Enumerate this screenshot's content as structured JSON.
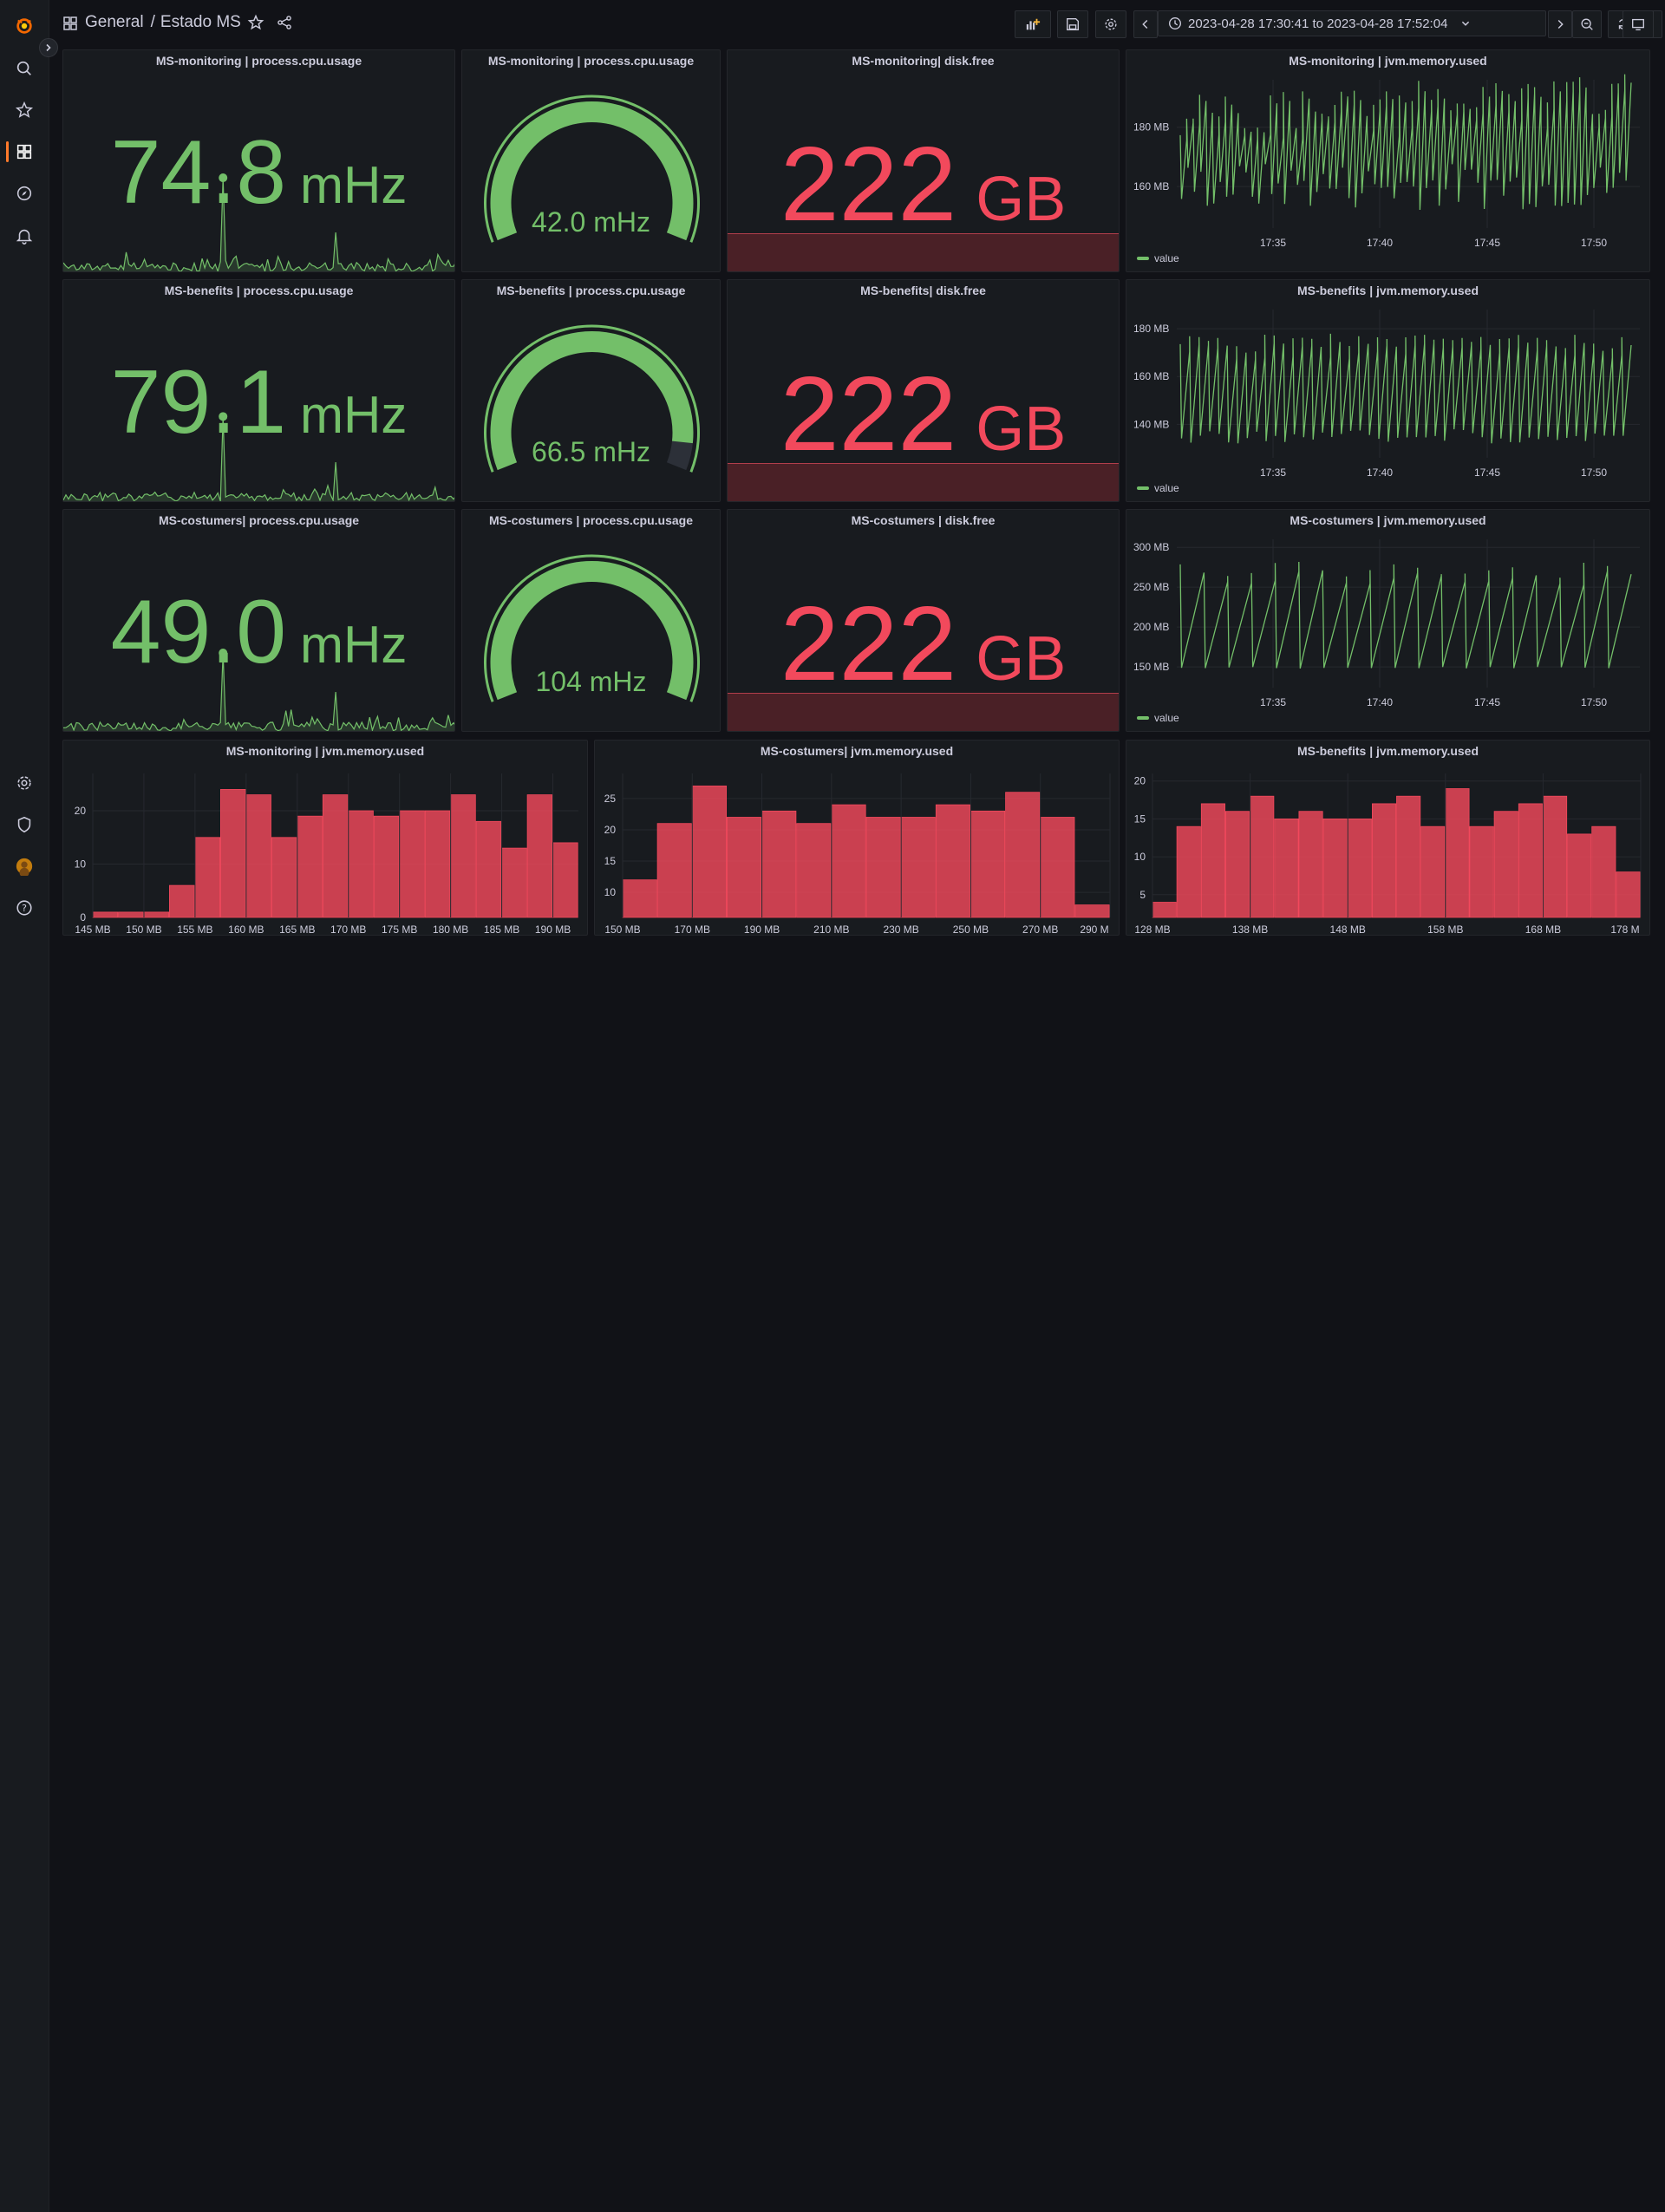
{
  "header": {
    "folder": "General",
    "separator": "/",
    "dashboard": "Estado MS",
    "time_range": "2023-04-28 17:30:41 to 2023-04-28 17:52:04"
  },
  "colors": {
    "green": "#73bf69",
    "red": "#f2495c",
    "bg": "#111217",
    "panel": "#181b1f"
  },
  "icons": {
    "sidebar": [
      "grafana-logo",
      "search-icon",
      "star-icon",
      "dashboards-icon",
      "explore-icon",
      "alerting-icon",
      "settings-icon",
      "shield-icon",
      "avatar",
      "help-icon"
    ],
    "toolbar": [
      "add-panel-icon",
      "save-icon",
      "settings-icon",
      "chevron-left-icon",
      "clock-icon",
      "chevron-down-icon",
      "chevron-right-icon",
      "zoom-out-icon",
      "refresh-icon",
      "chevron-down-icon",
      "tv-mode-icon"
    ]
  },
  "panels": {
    "cpu_stats": [
      {
        "title": "MS-monitoring | process.cpu.usage",
        "value": "74.8",
        "unit": "mHz",
        "spike_ratio": 0.42
      },
      {
        "title": "MS-benefits | process.cpu.usage",
        "value": "79.1",
        "unit": "mHz",
        "spike_ratio": 0.38
      },
      {
        "title": "MS-costumers| process.cpu.usage",
        "value": "49.0",
        "unit": "mHz",
        "spike_ratio": 0.35
      }
    ],
    "gauges": [
      {
        "title": "MS-monitoring | process.cpu.usage",
        "value": 42.0,
        "label": "42.0 mHz",
        "fraction": 1.0
      },
      {
        "title": "MS-benefits | process.cpu.usage",
        "value": 66.5,
        "label": "66.5 mHz",
        "fraction": 0.93
      },
      {
        "title": "MS-costumers | process.cpu.usage",
        "value": 104,
        "label": "104 mHz",
        "fraction": 1.0
      }
    ],
    "disk_stats": [
      {
        "title": "MS-monitoring| disk.free",
        "value": "222",
        "unit": "GB"
      },
      {
        "title": "MS-benefits| disk.free",
        "value": "222",
        "unit": "GB"
      },
      {
        "title": "MS-costumers | disk.free",
        "value": "222",
        "unit": "GB"
      }
    ],
    "timeseries": [
      {
        "title": "MS-monitoring | jvm.memory.used",
        "legend": "value"
      },
      {
        "title": "MS-benefits | jvm.memory.used",
        "legend": "value"
      },
      {
        "title": "MS-costumers | jvm.memory.used",
        "legend": "value"
      }
    ],
    "histograms": [
      {
        "title": "MS-monitoring | jvm.memory.used"
      },
      {
        "title": "MS-costumers| jvm.memory.used"
      },
      {
        "title": "MS-benefits | jvm.memory.used"
      }
    ]
  },
  "chart_data": [
    {
      "type": "line",
      "title": "MS-monitoring | jvm.memory.used",
      "x_ticks": [
        "17:35",
        "17:40",
        "17:45",
        "17:50"
      ],
      "y_ticks": [
        "160 MB",
        "180 MB"
      ],
      "ylim": [
        146,
        196
      ],
      "pattern": "sawtooth",
      "cycles": 70,
      "low": [
        152,
        168
      ],
      "high": [
        175,
        192
      ],
      "series": [
        {
          "name": "value"
        }
      ]
    },
    {
      "type": "line",
      "title": "MS-benefits | jvm.memory.used",
      "x_ticks": [
        "17:35",
        "17:40",
        "17:45",
        "17:50"
      ],
      "y_ticks": [
        "140 MB",
        "160 MB",
        "180 MB"
      ],
      "ylim": [
        126,
        188
      ],
      "pattern": "sawtooth",
      "cycles": 48,
      "low": [
        132,
        138
      ],
      "high": [
        170,
        178
      ],
      "series": [
        {
          "name": "value"
        }
      ]
    },
    {
      "type": "line",
      "title": "MS-costumers | jvm.memory.used",
      "x_ticks": [
        "17:35",
        "17:40",
        "17:45",
        "17:50"
      ],
      "y_ticks": [
        "150 MB",
        "200 MB",
        "250 MB",
        "300 MB"
      ],
      "ylim": [
        124,
        310
      ],
      "pattern": "sawtooth",
      "cycles": 19,
      "low": [
        148,
        150
      ],
      "high": [
        260,
        285
      ],
      "series": [
        {
          "name": "value"
        }
      ]
    },
    {
      "type": "bar",
      "title": "MS-monitoring | jvm.memory.used",
      "x_ticks": [
        "145 MB",
        "150 MB",
        "155 MB",
        "160 MB",
        "165 MB",
        "170 MB",
        "175 MB",
        "180 MB",
        "185 MB",
        "190 MB"
      ],
      "bin_start": 145,
      "bin_width": 2.5,
      "values": [
        1,
        1,
        1,
        6,
        15,
        24,
        23,
        15,
        19,
        23,
        20,
        19,
        20,
        20,
        23,
        18,
        13,
        23,
        14
      ],
      "y_ticks": [
        0,
        10,
        20
      ],
      "ylim": [
        0,
        27
      ]
    },
    {
      "type": "bar",
      "title": "MS-costumers| jvm.memory.used",
      "x_ticks": [
        "150 MB",
        "170 MB",
        "190 MB",
        "210 MB",
        "230 MB",
        "250 MB",
        "270 MB",
        "290 M"
      ],
      "bin_start": 150,
      "bin_width": 10,
      "values": [
        12,
        21,
        27,
        22,
        23,
        21,
        24,
        22,
        22,
        24,
        23,
        26,
        22,
        8
      ],
      "y_ticks": [
        10,
        15,
        20,
        25
      ],
      "ylim": [
        6,
        29
      ]
    },
    {
      "type": "bar",
      "title": "MS-benefits | jvm.memory.used",
      "x_ticks": [
        "128 MB",
        "138 MB",
        "148 MB",
        "158 MB",
        "168 MB",
        "178 M"
      ],
      "bin_start": 128,
      "bin_width": 2.5,
      "values": [
        4,
        14,
        17,
        16,
        18,
        15,
        16,
        15,
        15,
        17,
        18,
        14,
        19,
        14,
        16,
        17,
        18,
        13,
        14,
        8
      ],
      "y_ticks": [
        5,
        10,
        15,
        20
      ],
      "ylim": [
        2,
        21
      ]
    }
  ]
}
